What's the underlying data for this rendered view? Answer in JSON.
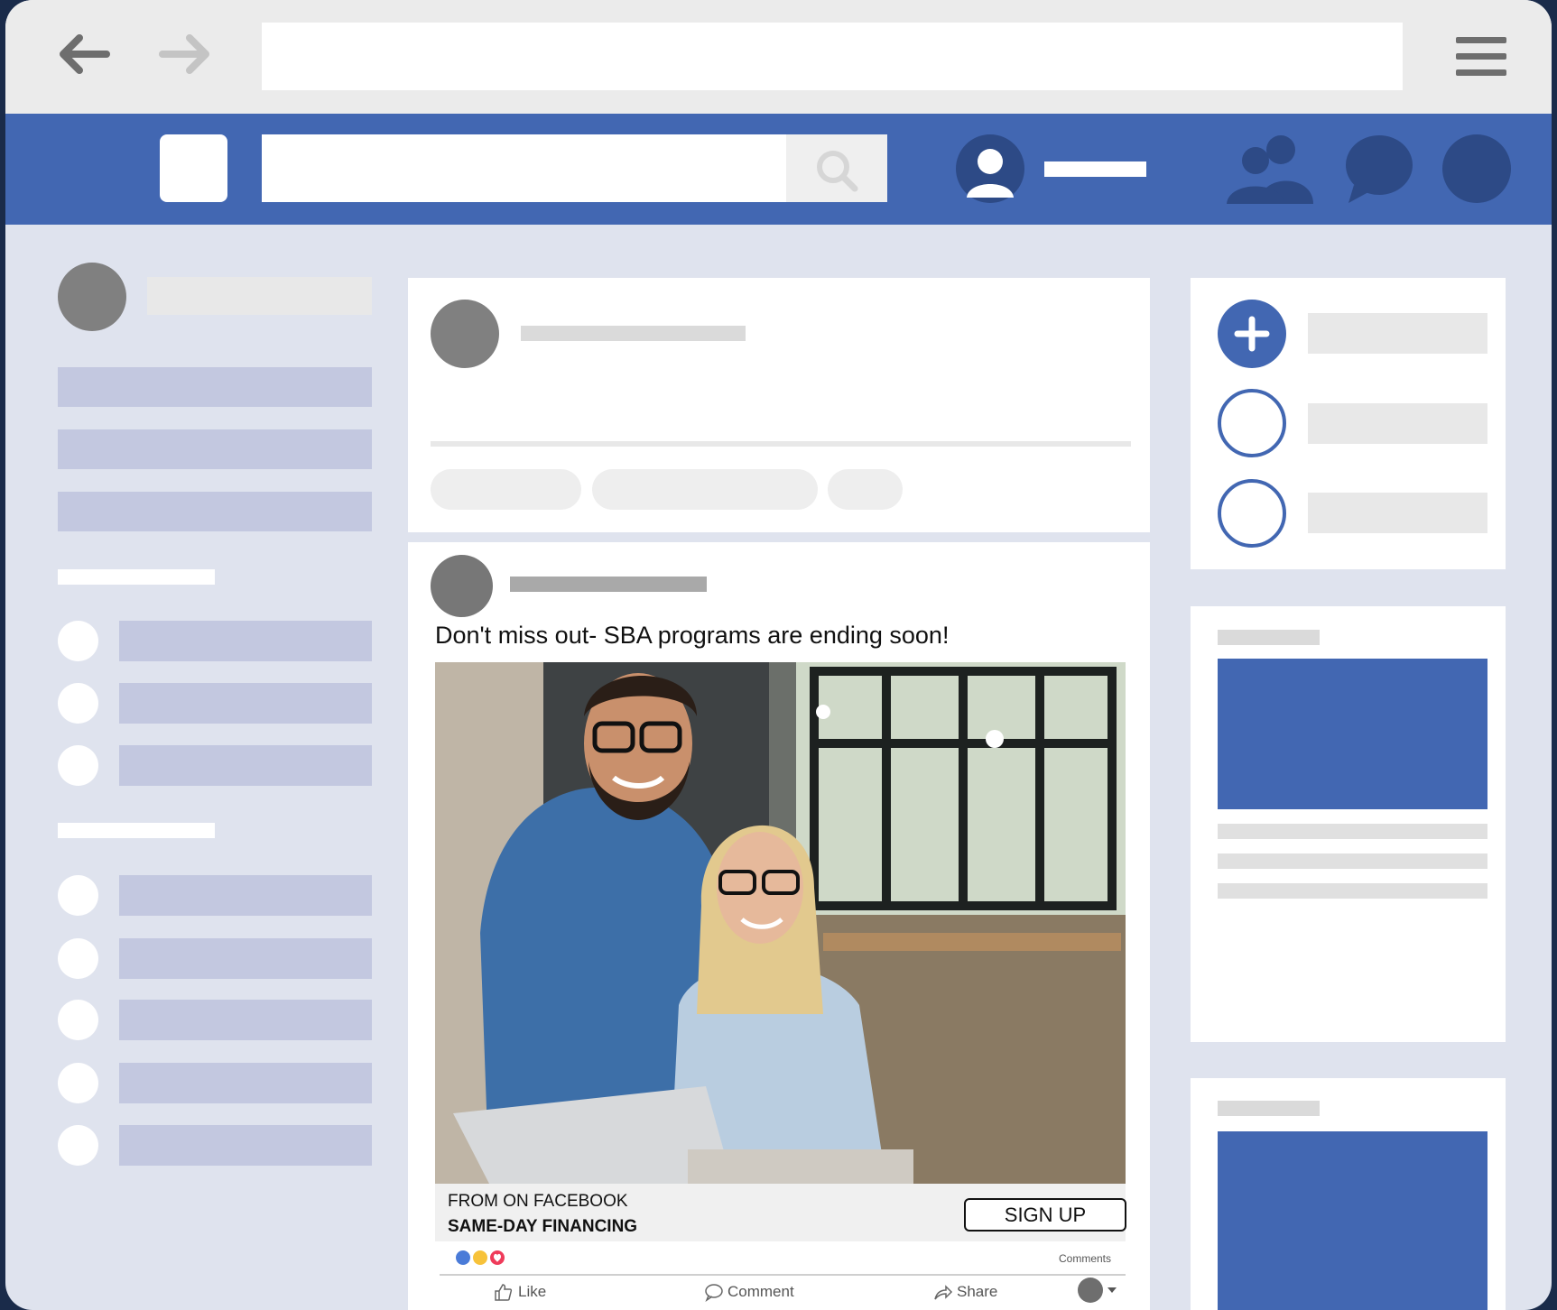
{
  "browser": {
    "back_icon": "back-arrow-icon",
    "forward_icon": "forward-arrow-icon",
    "menu_icon": "hamburger-menu-icon"
  },
  "facebook_bar": {
    "search_icon": "search-icon",
    "friends_icon": "friends-icon",
    "messages_icon": "chat-bubble-icon"
  },
  "post": {
    "text": "Don't miss out- SBA programs are ending soon!",
    "image_description_icon": "photo-two-people-laptop",
    "cta": {
      "from": "FROM ON FACEBOOK",
      "title": "SAME-DAY FINANCING",
      "button": "SIGN UP"
    },
    "comments_label": "Comments",
    "actions": {
      "like": "Like",
      "comment": "Comment",
      "share": "Share"
    }
  },
  "colors": {
    "facebook_blue": "#4267b2",
    "page_background": "#dfe3ee",
    "placeholder_lavender": "#c3c8e0"
  }
}
